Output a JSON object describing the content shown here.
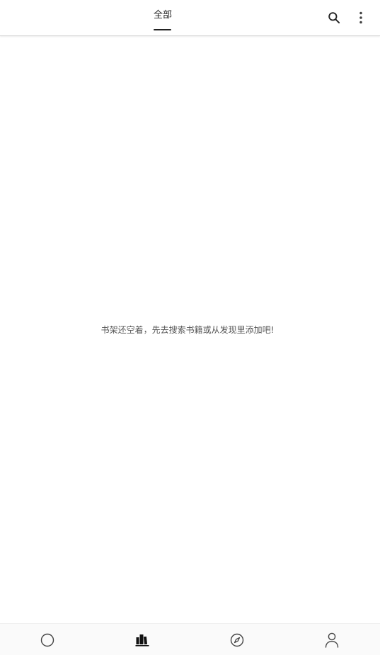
{
  "header": {
    "tabs": [
      {
        "label": "全部",
        "selected": true
      }
    ],
    "actions": {
      "search_icon": "search-icon",
      "more_icon": "more-vertical-icon"
    }
  },
  "bookshelf": {
    "empty_message": "书架还空着，先去搜索书籍或从发现里添加吧!"
  },
  "bottom_nav": {
    "items": [
      {
        "icon": "circle-icon",
        "selected": false
      },
      {
        "icon": "bookshelf-icon",
        "selected": true
      },
      {
        "icon": "compass-icon",
        "selected": false
      },
      {
        "icon": "person-icon",
        "selected": false
      }
    ]
  },
  "colors": {
    "text_primary": "#222222",
    "text_secondary": "#555555",
    "icon": "#444444",
    "background": "#ffffff",
    "nav_background": "#fafafa"
  }
}
